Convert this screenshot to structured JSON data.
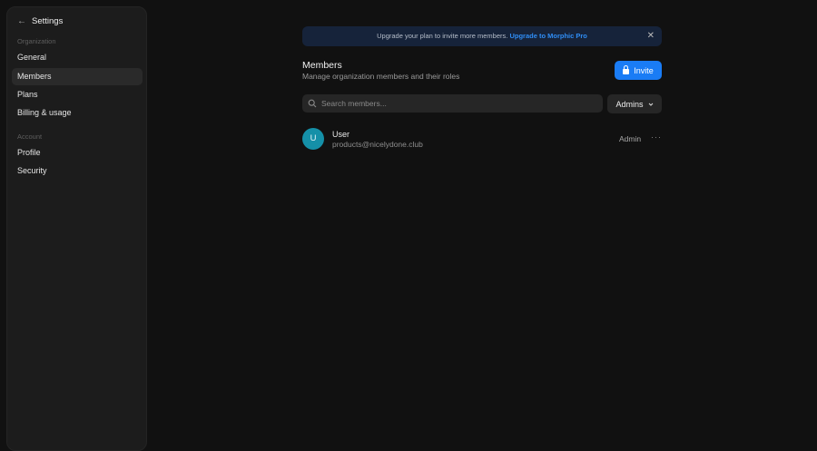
{
  "sidebar": {
    "back_label": "Settings",
    "sections": [
      {
        "label": "Organization",
        "items": [
          "General",
          "Members",
          "Plans",
          "Billing & usage"
        ]
      },
      {
        "label": "Account",
        "items": [
          "Profile",
          "Security"
        ]
      }
    ],
    "active": "Members"
  },
  "banner": {
    "text": "Upgrade your plan to invite more members.",
    "link": "Upgrade to Morphic Pro",
    "close": "✕"
  },
  "header": {
    "title": "Members",
    "subtitle": "Manage organization members and their roles",
    "invite_label": "Invite"
  },
  "search": {
    "placeholder": "Search members...",
    "value": ""
  },
  "filter": {
    "selected": "Admins"
  },
  "members": [
    {
      "initial": "U",
      "name": "User",
      "email": "products@nicelydone.club",
      "role": "Admin",
      "more": "···"
    }
  ],
  "colors": {
    "accent": "#1a7cf5",
    "avatar": "#1590a8"
  }
}
